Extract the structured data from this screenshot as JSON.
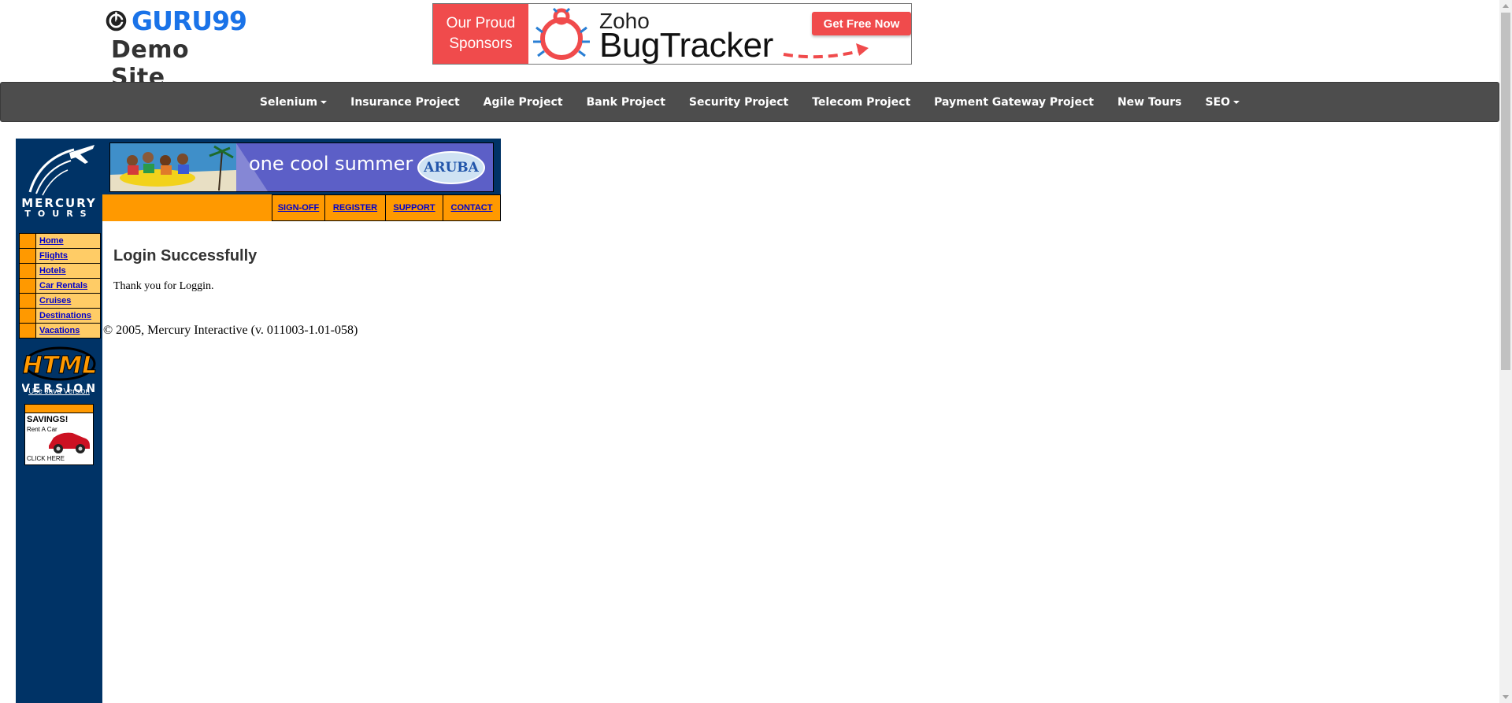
{
  "header": {
    "logo_brand": "GURU99",
    "logo_subtitle": "Demo Site"
  },
  "sponsor": {
    "label_line1": "Our Proud",
    "label_line2": "Sponsors",
    "product_vendor": "Zoho",
    "product_name": "BugTracker",
    "cta": "Get Free Now"
  },
  "nav": {
    "items": [
      {
        "label": "Selenium",
        "dropdown": true
      },
      {
        "label": "Insurance Project",
        "dropdown": false
      },
      {
        "label": "Agile Project",
        "dropdown": false
      },
      {
        "label": "Bank Project",
        "dropdown": false
      },
      {
        "label": "Security Project",
        "dropdown": false
      },
      {
        "label": "Telecom Project",
        "dropdown": false
      },
      {
        "label": "Payment Gateway Project",
        "dropdown": false
      },
      {
        "label": "New Tours",
        "dropdown": false
      },
      {
        "label": "SEO",
        "dropdown": true
      }
    ]
  },
  "mercury": {
    "logo_line1": "MERCURY",
    "logo_line2": "TOURS",
    "banner_text": "one cool summer",
    "banner_badge": "ARUBA",
    "top_links": [
      "SIGN-OFF",
      "REGISTER",
      "SUPPORT",
      "CONTACT"
    ],
    "menu": [
      "Home",
      "Flights",
      "Hotels",
      "Car Rentals",
      "Cruises",
      "Destinations",
      "Vacations"
    ],
    "version_line1": "HTML",
    "version_line2": "VERSION",
    "java_link": "Use Java Version",
    "ad_title": "SAVINGS!",
    "ad_sub": "Rent A Car",
    "ad_cta": "CLICK HERE",
    "heading": "Login Successfully",
    "message": "Thank you for Loggin.",
    "copyright": "© 2005, Mercury Interactive (v. 011003-1.01-058)"
  },
  "colors": {
    "nav_bg": "#4d4d4d",
    "brand_blue": "#1a73e8",
    "sponsor_red": "#f04b4c",
    "mercury_navy": "#003366",
    "mercury_orange": "#ff9900",
    "link_blue": "#0000cc"
  }
}
